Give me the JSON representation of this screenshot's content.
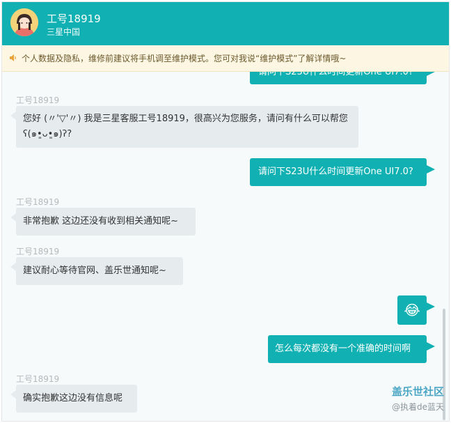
{
  "header": {
    "agent_name": "工号18919",
    "organization": "三星中国"
  },
  "notice": {
    "text": "个人数据及隐私，维修前建议将手机调至维护模式。您可对我说“维护模式”了解详情哦~"
  },
  "messages": [
    {
      "from": "user",
      "text": "请问下S23U什么时间更新One UI7.0?",
      "partial": true
    },
    {
      "from": "agent",
      "sender": "工号18919",
      "text": "您好 (〃'▽'〃) 我是三星客服工号18919，很高兴为您服务，请问有什么可以帮您ʕ(๑•͈ᴗ•͈๑)ʔ?"
    },
    {
      "from": "user",
      "text": "请问下S23U什么时间更新One UI7.0?"
    },
    {
      "from": "agent",
      "sender": "工号18919",
      "text": "非常抱歉 这边还没有收到相关通知呢~"
    },
    {
      "from": "agent",
      "sender": "工号18919",
      "text": "建议耐心等待官网、盖乐世通知呢~"
    },
    {
      "from": "user",
      "emoji": "😂"
    },
    {
      "from": "user",
      "text": "怎么每次都没有一个准确的时间啊"
    },
    {
      "from": "agent",
      "sender": "工号18919",
      "text": "确实抱歉这边没有信息呢"
    }
  ],
  "watermark": {
    "line1": "盖乐世社区",
    "line2": "@执着de蓝天"
  },
  "colors": {
    "accent": "#11b1b3",
    "notice_bg": "#fdf6e3",
    "agent_bubble": "#e6ebee"
  }
}
